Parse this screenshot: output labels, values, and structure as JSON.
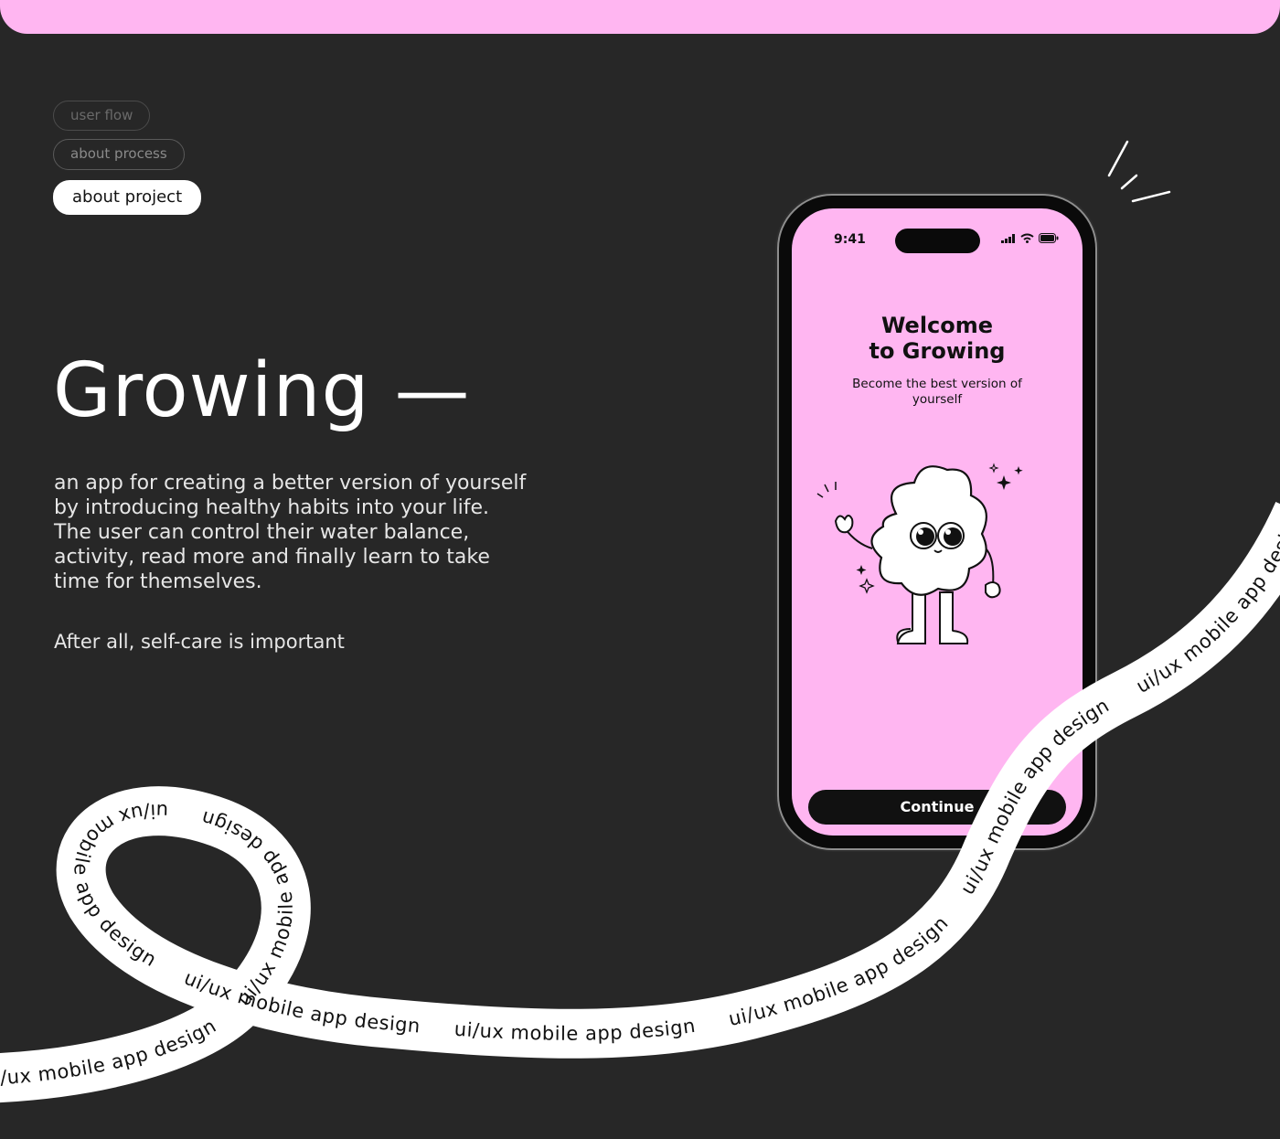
{
  "nav": {
    "pills": [
      "user flow",
      "about process"
    ],
    "active": "about project"
  },
  "hero": {
    "title": "Growing —",
    "description": "an app for creating a better version of yourself by introducing healthy habits into your life. The user can control their water balance, activity, read more and finally learn to take time for themselves.",
    "tagline": "After all, self-care is important"
  },
  "phone": {
    "time": "9:41",
    "welcome_line1": "Welcome",
    "welcome_line2": "to Growing",
    "subtitle": "Become the best version of yourself",
    "button": "Continue"
  },
  "ribbon": {
    "text": "ui/ux mobile app design"
  },
  "colors": {
    "background": "#272727",
    "accent_pink": "#ffb6f1",
    "white": "#ffffff"
  }
}
